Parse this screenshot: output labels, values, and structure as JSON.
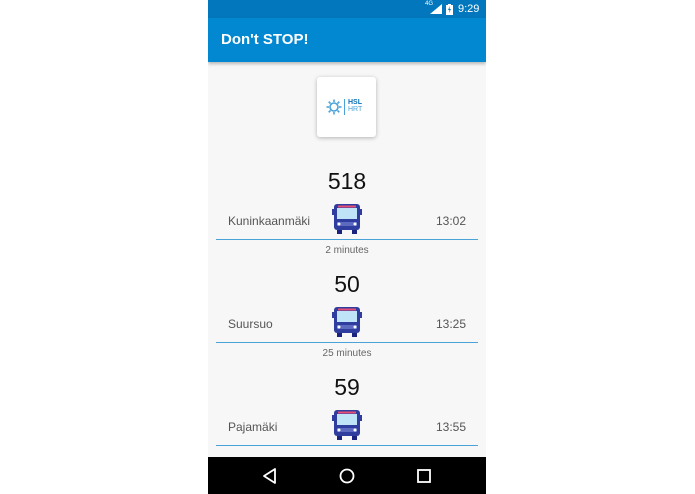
{
  "statusbar": {
    "network": "4G",
    "time": "9:29"
  },
  "appbar": {
    "title": "Don't STOP!"
  },
  "logo": {
    "line1": "HSL",
    "line2": "HRT"
  },
  "routes": [
    {
      "number": "518",
      "destination": "Kuninkaanmäki",
      "departure": "13:02",
      "wait": "2 minutes"
    },
    {
      "number": "50",
      "destination": "Suursuo",
      "departure": "13:25",
      "wait": "25 minutes"
    },
    {
      "number": "59",
      "destination": "Pajamäki",
      "departure": "13:55"
    }
  ],
  "navbar": {
    "icons": [
      "back-icon",
      "home-icon",
      "recents-icon"
    ]
  },
  "colors": {
    "appbar": "#0288d1",
    "statusbar": "#0277bd",
    "accent": "#4aa3d8"
  }
}
